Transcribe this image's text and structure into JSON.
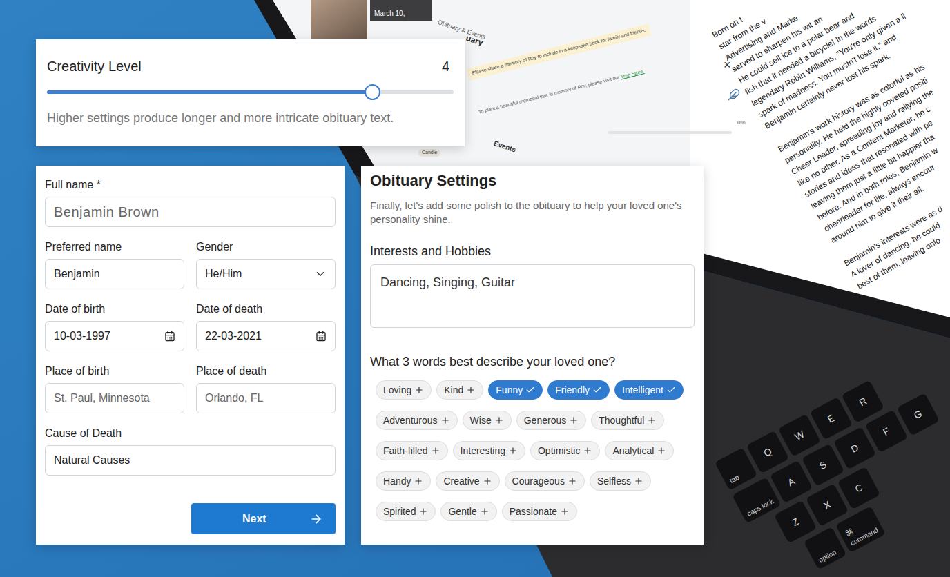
{
  "laptop": {
    "date_strip": "March 10,",
    "page_tab": "Obituary & Events",
    "heading": "uary",
    "memory_banner": "Please share a memory of Roy to include in a keepsake book for family and friends.",
    "tree_note": "To plant a beautiful memorial tree in memory of Roy, please visit our",
    "tree_link": "Tree Store.",
    "chip": "Candle",
    "close": "×",
    "progress": {
      "reading": "0%",
      "level": 0
    },
    "events": "Events",
    "obituary_paragraphs": [
      [
        "Born on t",
        "star from the v",
        "Advertising and Marke",
        "served to sharpen his wit an",
        "He could sell ice to a polar bear and",
        "fish that it needed a bicycle! In the words",
        "legendary Robin Williams, \"You're only given a li",
        "spark of madness. You mustn't lose it,\" and",
        "Benjamin certainly never lost his spark."
      ],
      [
        "Benjamin's work history was as colorful as his",
        "personality. He held the highly coveted positi",
        "Cheer Leader, spreading joy and rallying the",
        "like no other. As a Content Marketer, he c",
        "stories and ideas that resonated with pe",
        "leaving them just a little bit happier tha",
        "before. And in both roles, Benjamin w",
        "cheerleader for life, always encour",
        "around him to give it their all."
      ],
      [
        "Benjamin's interests were as d",
        "A lover of dancing, he could",
        "best of them, leaving onlo"
      ]
    ],
    "keyboard_rows": [
      [
        {
          "label": "tab"
        },
        {
          "label": "Q"
        },
        {
          "label": "W"
        },
        {
          "label": "E"
        },
        {
          "label": "R"
        }
      ],
      [
        {
          "label": "caps lock"
        },
        {
          "label": "A"
        },
        {
          "label": "S"
        },
        {
          "label": "D"
        },
        {
          "label": "F"
        },
        {
          "label": "G"
        }
      ],
      [
        {
          "label": "Z"
        },
        {
          "label": "X"
        },
        {
          "label": "C"
        }
      ],
      [
        {
          "label": "option"
        },
        {
          "label": "command",
          "symbol": "⌘"
        }
      ]
    ]
  },
  "creativity": {
    "title": "Creativity Level",
    "value": "4",
    "level": 0.8,
    "hint": "Higher settings produce longer and more intricate obituary text."
  },
  "form": {
    "full_name": {
      "label": "Full name *",
      "value": "Benjamin Brown",
      "kind": "text",
      "muted": true
    },
    "pairs": [
      [
        {
          "label": "Preferred name",
          "value": "Benjamin",
          "kind": "text",
          "muted": false
        },
        {
          "label": "Gender",
          "value": "He/Him",
          "kind": "select",
          "muted": false
        }
      ],
      [
        {
          "label": "Date of birth",
          "value": "10-03-1997",
          "kind": "date",
          "muted": false
        },
        {
          "label": "Date of death",
          "value": "22-03-2021",
          "kind": "date",
          "muted": false
        }
      ],
      [
        {
          "label": "Place of birth",
          "value": "St. Paul, Minnesota",
          "kind": "text",
          "muted": true
        },
        {
          "label": "Place of death",
          "value": "Orlando, FL",
          "kind": "text",
          "muted": true
        }
      ]
    ],
    "cause": {
      "label": "Cause of Death",
      "value": "Natural Causes",
      "kind": "text",
      "muted": false
    },
    "next_button": "Next"
  },
  "settings": {
    "title": "Obituary Settings",
    "subtitle": "Finally, let's add some polish to the obituary to help your loved one's personality shine.",
    "interests_label": "Interests and Hobbies",
    "interests_value": "Dancing, Singing, Guitar",
    "traits_question": "What 3 words best describe your loved one?",
    "traits": [
      {
        "label": "Loving",
        "selected": false
      },
      {
        "label": "Kind",
        "selected": false
      },
      {
        "label": "Funny",
        "selected": true
      },
      {
        "label": "Friendly",
        "selected": true
      },
      {
        "label": "Intelligent",
        "selected": true
      },
      {
        "label": "Adventurous",
        "selected": false
      },
      {
        "label": "Wise",
        "selected": false
      },
      {
        "label": "Generous",
        "selected": false
      },
      {
        "label": "Thoughtful",
        "selected": false
      },
      {
        "label": "Faith-filled",
        "selected": false
      },
      {
        "label": "Interesting",
        "selected": false
      },
      {
        "label": "Optimistic",
        "selected": false
      },
      {
        "label": "Analytical",
        "selected": false
      },
      {
        "label": "Handy",
        "selected": false
      },
      {
        "label": "Creative",
        "selected": false
      },
      {
        "label": "Courageous",
        "selected": false
      },
      {
        "label": "Selfless",
        "selected": false
      },
      {
        "label": "Spirited",
        "selected": false
      },
      {
        "label": "Gentle",
        "selected": false
      },
      {
        "label": "Passionate",
        "selected": false
      }
    ]
  }
}
